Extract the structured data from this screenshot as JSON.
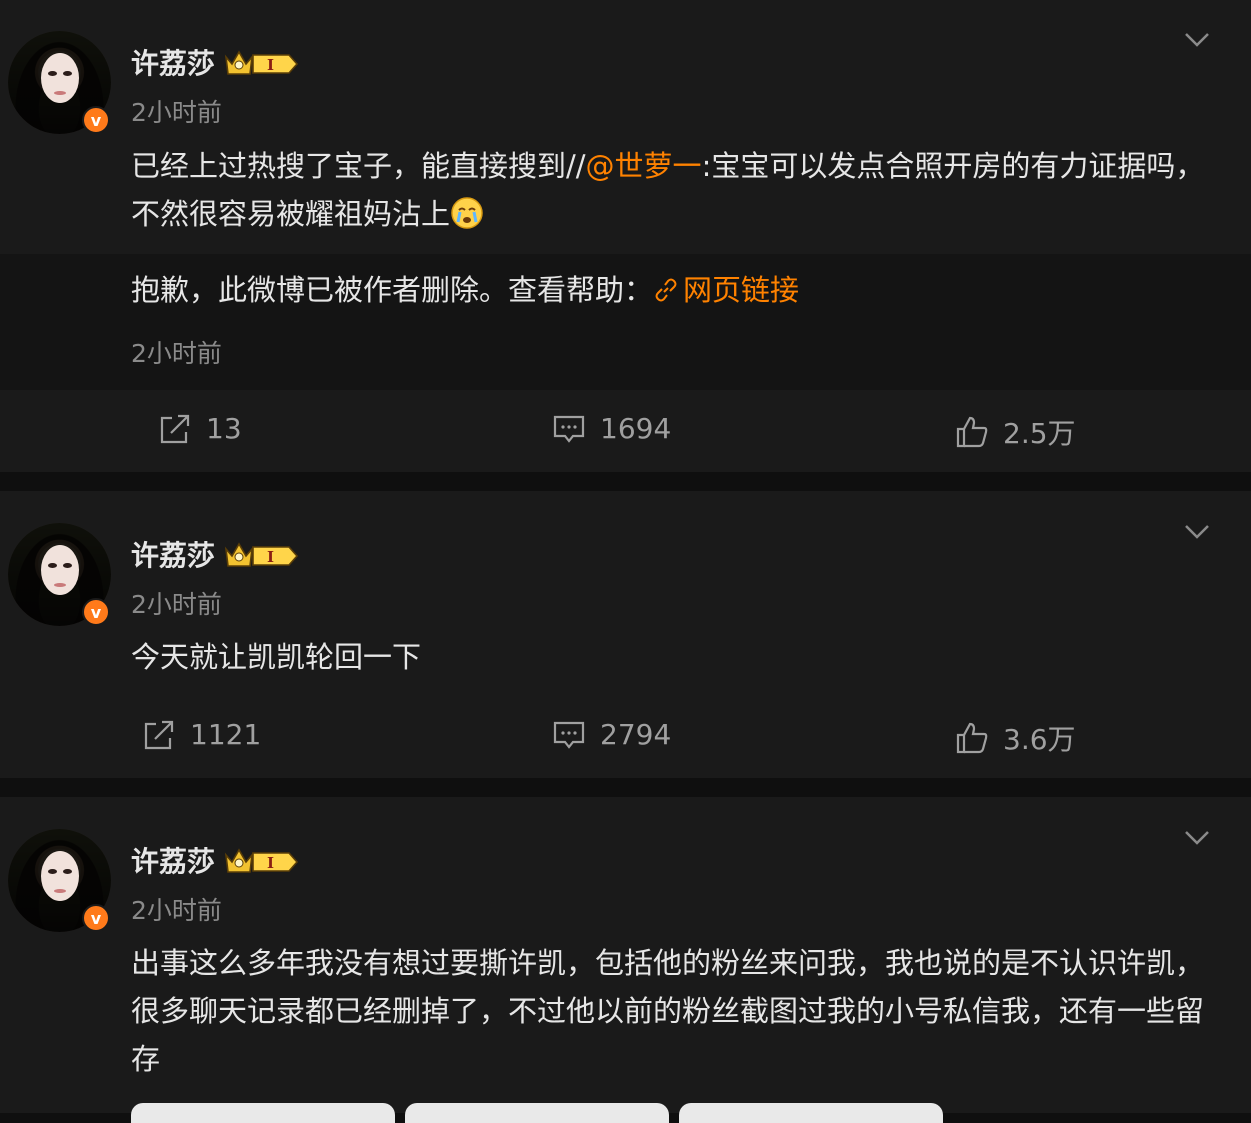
{
  "posts": [
    {
      "author": "许荔莎",
      "verified_badge": "v",
      "time": "2小时前",
      "text_before": "已经上过热搜了宝子，能直接搜到//",
      "mention": "@世萝一",
      "text_after": ":宝宝可以发点合照开房的有力证据吗，不然很容易被耀祖妈沾上",
      "emoji": "crying-face",
      "quote": {
        "text": "抱歉，此微博已被作者删除。查看帮助：",
        "link_label": "网页链接",
        "time": "2小时前"
      },
      "actions": {
        "share": "13",
        "comment": "1694",
        "like": "2.5万"
      }
    },
    {
      "author": "许荔莎",
      "verified_badge": "v",
      "time": "2小时前",
      "text": "今天就让凯凯轮回一下",
      "actions": {
        "share": "1121",
        "comment": "2794",
        "like": "3.6万"
      }
    },
    {
      "author": "许荔莎",
      "verified_badge": "v",
      "time": "2小时前",
      "text": "出事这么多年我没有想过要撕许凯，包括他的粉丝来问我，我也说的是不认识许凯，很多聊天记录都已经删掉了，不过他以前的粉丝截图过我的小号私信我，还有一些留存"
    }
  ],
  "colors": {
    "accent": "#ff8200",
    "background": "#1a1a1a",
    "text": "#e6e6e6",
    "muted": "#8a8a8a"
  }
}
